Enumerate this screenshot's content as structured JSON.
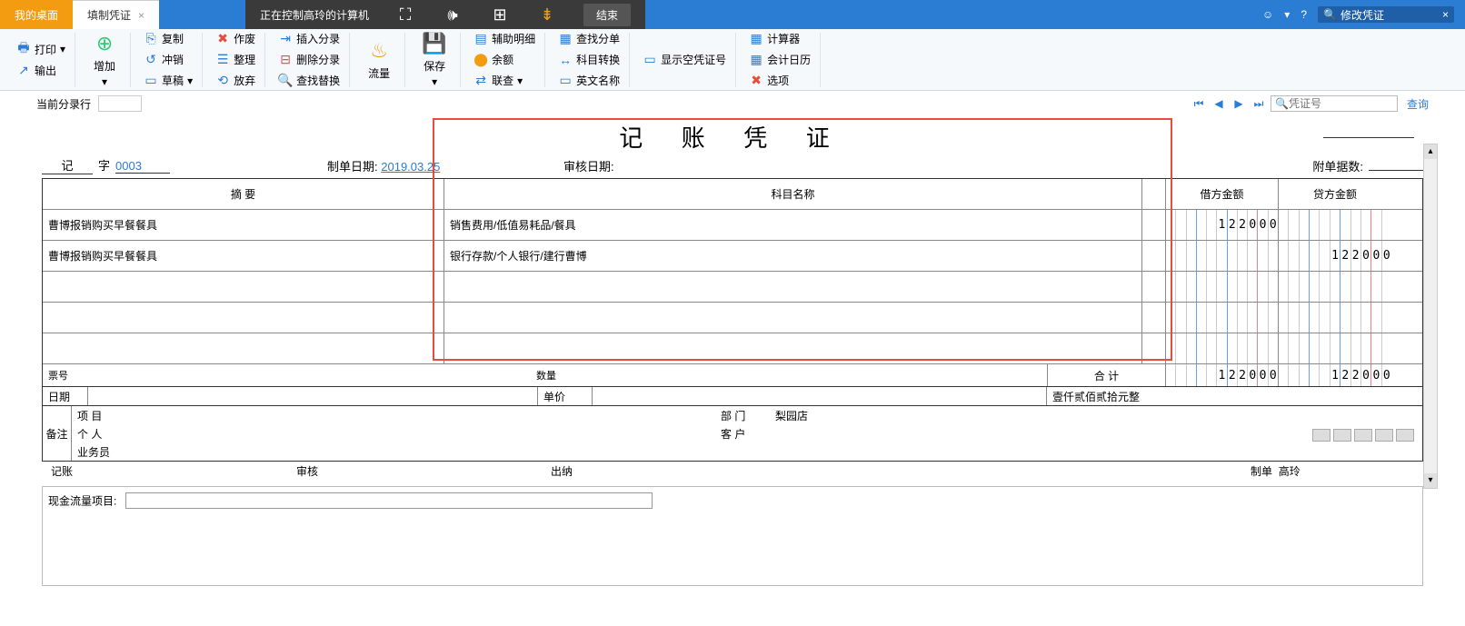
{
  "tabs": {
    "desktop": "我的桌面",
    "voucher": "填制凭证"
  },
  "remote": {
    "text": "正在控制高玲的计算机",
    "end": "结束"
  },
  "search_top": {
    "value": "修改凭证"
  },
  "ribbon": {
    "print": "打印",
    "output": "输出",
    "add": "增加",
    "copy": "复制",
    "offset": "冲销",
    "draft": "草稿",
    "void": "作废",
    "tidy": "整理",
    "abandon": "放弃",
    "insert": "插入分录",
    "delete": "删除分录",
    "findrep": "查找替换",
    "flow": "流量",
    "save": "保存",
    "aux": "辅助明细",
    "amount": "余额",
    "link": "联查",
    "findsplit": "查找分单",
    "subjconv": "科目转换",
    "enname": "英文名称",
    "showempty": "显示空凭证号",
    "calc": "计算器",
    "calendar": "会计日历",
    "options": "选项"
  },
  "subrow": {
    "label": "当前分录行",
    "voucher_no_ph": "凭证号",
    "query": "查询"
  },
  "voucher": {
    "title": "记 账 凭 证",
    "prefix": "记",
    "zi": "字",
    "seq": "0003",
    "make_date_lbl": "制单日期:",
    "make_date": "2019.03.25",
    "audit_date_lbl": "审核日期:",
    "attach_lbl": "附单据数:",
    "headers": {
      "summary": "摘 要",
      "subject": "科目名称",
      "debit": "借方金额",
      "credit": "贷方金额"
    },
    "rows": [
      {
        "summary": "曹博报销购买早餐餐具",
        "subject": "销售费用/低值易耗品/餐具",
        "debit": "122000",
        "credit": ""
      },
      {
        "summary": "曹博报销购买早餐餐具",
        "subject": "银行存款/个人银行/建行曹博",
        "debit": "",
        "credit": "122000"
      },
      {
        "summary": "",
        "subject": "",
        "debit": "",
        "credit": ""
      },
      {
        "summary": "",
        "subject": "",
        "debit": "",
        "credit": ""
      },
      {
        "summary": "",
        "subject": "",
        "debit": "",
        "credit": ""
      }
    ],
    "ticket_lbl": "票号",
    "date_lbl": "日期",
    "qty_lbl": "数量",
    "price_lbl": "单价",
    "total_lbl": "合 计",
    "total_debit": "122000",
    "total_credit": "122000",
    "total_cn": "壹仟贰佰贰拾元整",
    "remark_lbl": "备注",
    "project_lbl": "项 目",
    "dept_lbl": "部 门",
    "dept_val": "梨园店",
    "person_lbl": "个 人",
    "cust_lbl": "客 户",
    "biz_lbl": "业务员",
    "sign": {
      "book": "记账",
      "audit": "审核",
      "cashier": "出纳",
      "maker": "制单",
      "maker_val": "高玲"
    }
  },
  "cashflow": {
    "label": "现金流量项目:"
  }
}
